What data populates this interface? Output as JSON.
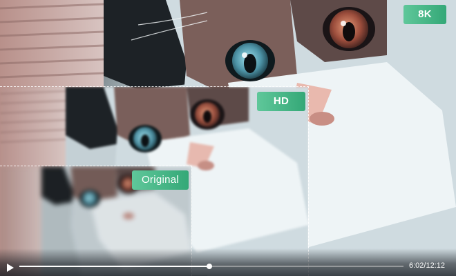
{
  "resolutions": {
    "k8_label": "8K",
    "hd_label": "HD",
    "original_label": "Original"
  },
  "player": {
    "current_time": "6:02",
    "separator": "/",
    "total_time": "12:12",
    "progress": 0.4945,
    "play_icon": "play-icon"
  },
  "colors": {
    "badge_start": "#5fc79a",
    "badge_end": "#34a877",
    "fur_white": "#e6f0f4",
    "iris_teal": "#6fb6c4",
    "iris_amber": "#b5644a"
  }
}
